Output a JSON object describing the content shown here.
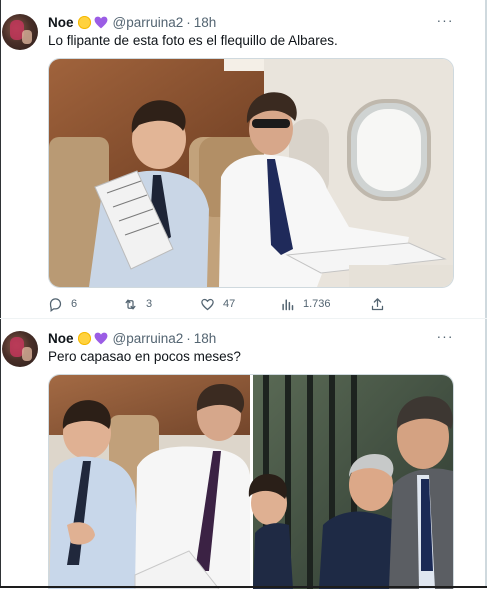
{
  "tweets": [
    {
      "author": {
        "name": "Noe",
        "handle": "@parruina2",
        "emoji": [
          "sun-emoji",
          "purple-heart-emoji"
        ]
      },
      "time": "18h",
      "text": "Lo flipante de esta foto es el flequillo de Albares.",
      "media": {
        "type": "photo",
        "description_icon": "photo-airplane-cabin"
      },
      "actions": {
        "replies": "6",
        "retweets": "3",
        "likes": "47",
        "views": "1.736"
      }
    },
    {
      "author": {
        "name": "Noe",
        "handle": "@parruina2",
        "emoji": [
          "sun-emoji",
          "purple-heart-emoji"
        ]
      },
      "time": "18h",
      "text": "Pero capasao en pocos meses?",
      "media": {
        "type": "photo-pair",
        "description_icon": "photo-collage"
      }
    }
  ],
  "ui": {
    "separator": "·",
    "more_label": "···"
  },
  "colors": {
    "text": "#0f1419",
    "muted": "#536471",
    "border": "#eff3f4",
    "heart": "#9b5de5",
    "sun": "#ffd23f"
  }
}
